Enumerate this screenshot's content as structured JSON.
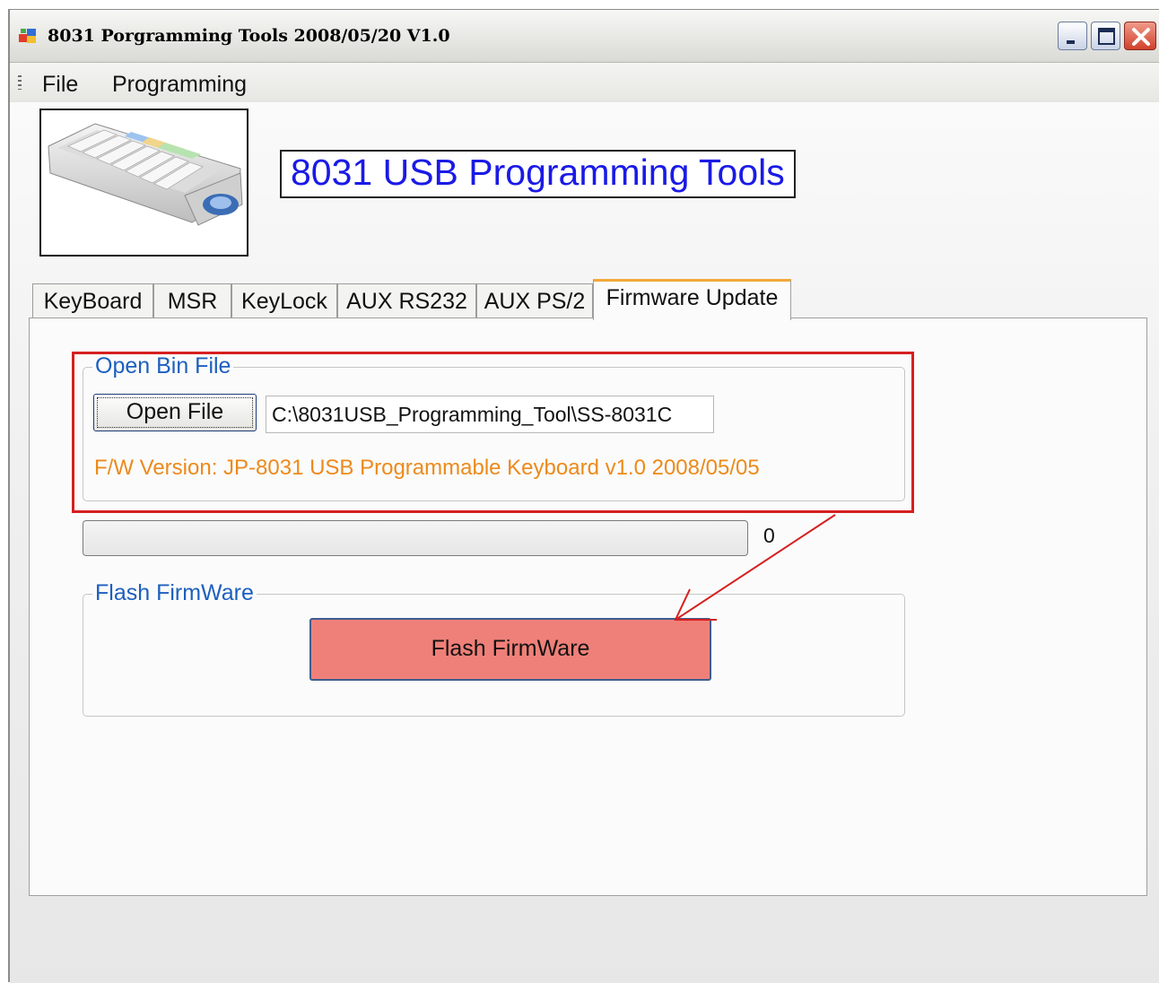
{
  "window": {
    "title": "8031 Porgramming Tools 2008/05/20 V1.0"
  },
  "menu": {
    "items": [
      "File",
      "Programming"
    ]
  },
  "header": {
    "banner": "8031 USB Programming Tools"
  },
  "tabs": [
    {
      "label": "KeyBoard",
      "active": false
    },
    {
      "label": "MSR",
      "active": false
    },
    {
      "label": "KeyLock",
      "active": false
    },
    {
      "label": "AUX RS232",
      "active": false
    },
    {
      "label": "AUX PS/2",
      "active": false
    },
    {
      "label": "Firmware Update",
      "active": true
    }
  ],
  "open_bin_group": {
    "title": "Open Bin File",
    "open_button": "Open File",
    "file_path": "C:\\8031USB_Programming_Tool\\SS-8031C",
    "fw_version": "F/W Version: JP-8031 USB Programmable Keyboard v1.0 2008/05/05"
  },
  "progress": {
    "value": 0,
    "label": "0"
  },
  "flash_group": {
    "title": "Flash FirmWare",
    "button": "Flash FirmWare"
  },
  "colors": {
    "banner_text": "#1a1ae6",
    "group_title": "#1d5fbf",
    "fw_version": "#ec8a1b",
    "highlight": "#d61f1f",
    "flash_button": "#ef8079",
    "active_tab_accent": "#f2a93a"
  }
}
